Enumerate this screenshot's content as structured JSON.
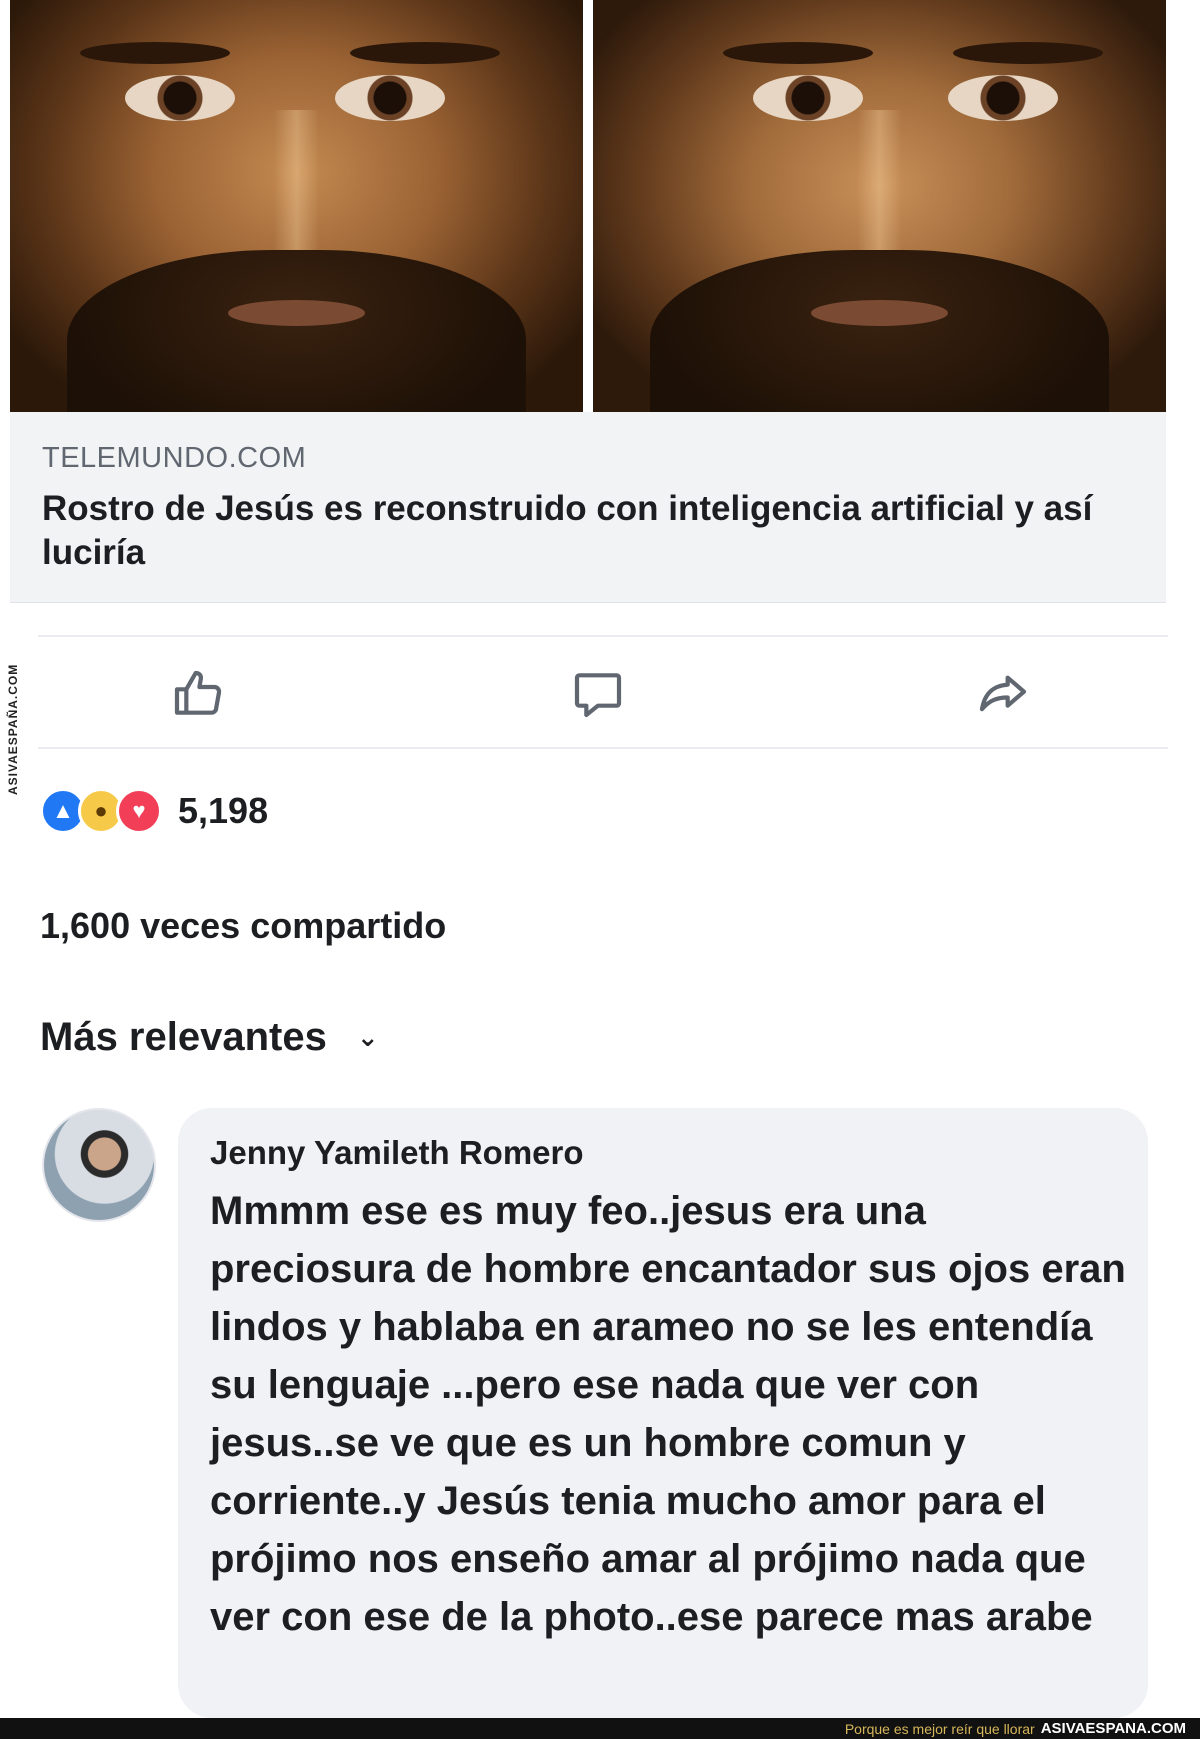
{
  "post": {
    "link_preview": {
      "domain": "TELEMUNDO.COM",
      "headline": "Rostro de Jesús es reconstruido con inteligencia artificial y así luciría"
    },
    "actions": {
      "like_icon": "thumbs-up-icon",
      "comment_icon": "comment-bubble-icon",
      "share_icon": "share-arrow-icon"
    },
    "reactions": {
      "icons": [
        "like",
        "wow",
        "love"
      ],
      "count": "5,198"
    },
    "shares_text": "1,600 veces compartido",
    "sort_label": "Más relevantes"
  },
  "comment": {
    "author": "Jenny Yamileth Romero",
    "text": "Mmmm ese es muy feo..jesus era una preciosura de hombre encantador  sus ojos eran lindos y hablaba en arameo no se les entendía su lenguaje ...pero ese nada que ver con jesus..se ve que es un hombre comun y corriente..y Jesús tenia mucho amor para el prójimo nos enseño amar al prójimo nada que ver con ese de la photo..ese parece mas arabe"
  },
  "watermark": {
    "vertical": "ASIVAESPAÑA.COM",
    "footer_tagline": "Porque es mejor reír que llorar",
    "footer_site": "ASIVAESPANA.COM"
  },
  "colors": {
    "like_blue": "#2078f4",
    "love_red": "#f33e58",
    "wow_yellow": "#f7c948",
    "comment_bubble": "#f0f2f5",
    "preview_bg": "#f2f3f5"
  }
}
